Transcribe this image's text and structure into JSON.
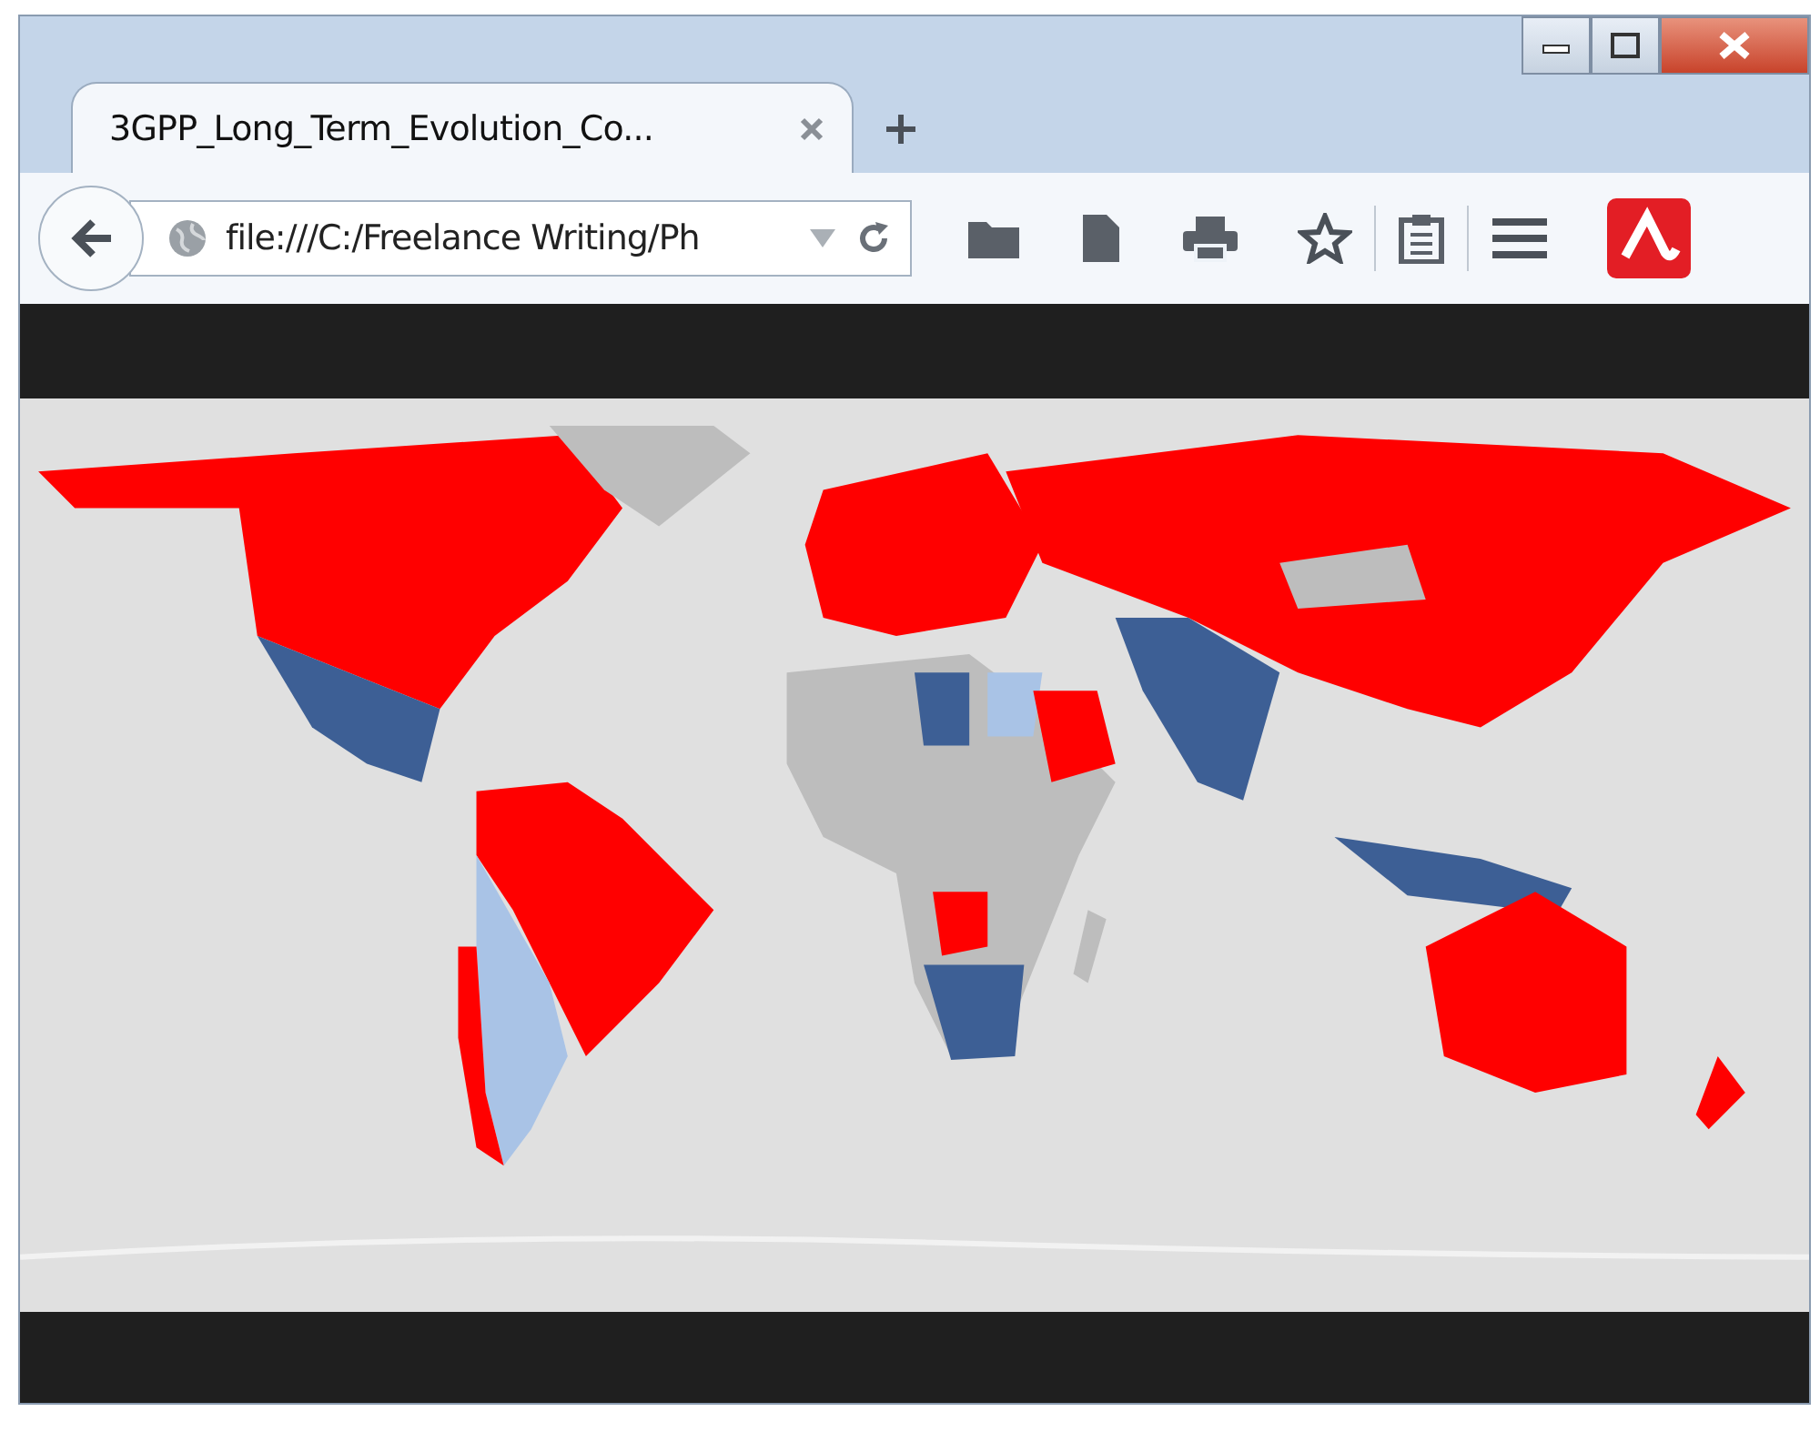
{
  "tabs": [
    {
      "label": "3GPP_Long_Term_Evolution_Co...",
      "selected": true
    }
  ],
  "address_bar": {
    "value": "file:///C:/Freelance Writing/Ph"
  }
}
